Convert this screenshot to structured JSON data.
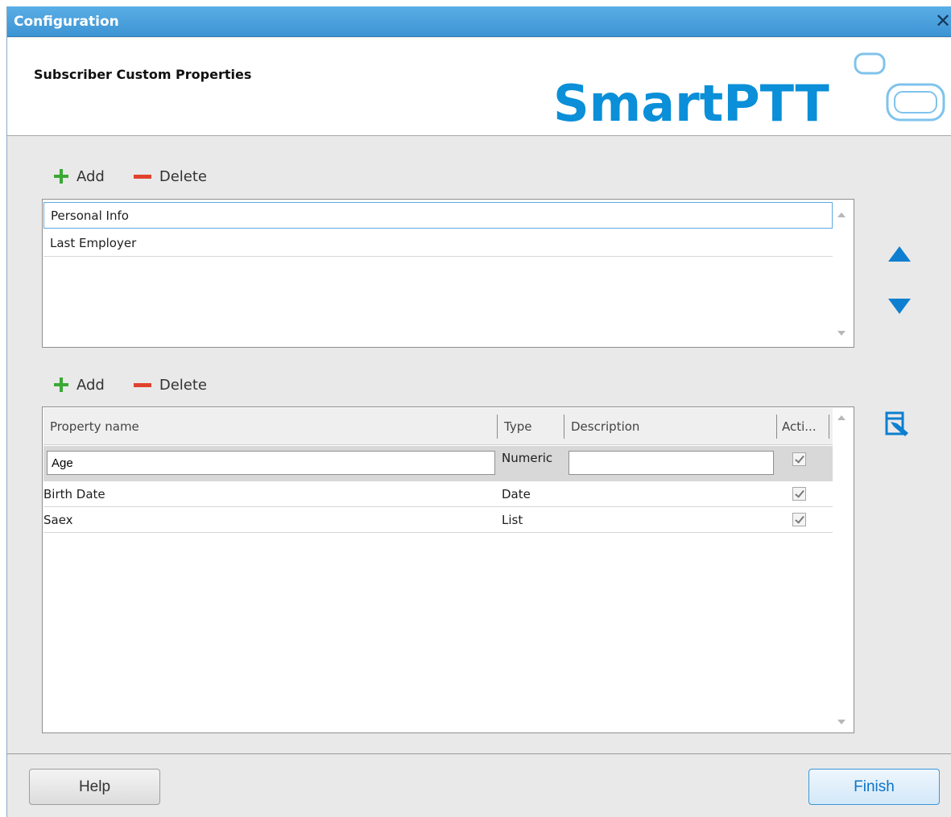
{
  "window": {
    "title": "Configuration",
    "close_glyph": "✕"
  },
  "header": {
    "heading": "Subscriber Custom Properties",
    "logo_text": "SmartPTT"
  },
  "groups_toolbar": {
    "add_label": "Add",
    "delete_label": "Delete"
  },
  "groups_list": {
    "items": [
      "Personal Info",
      "Last Employer"
    ],
    "selected_index": 0
  },
  "properties_toolbar": {
    "add_label": "Add",
    "delete_label": "Delete"
  },
  "properties_grid": {
    "columns": [
      "Property name",
      "Type",
      "Description",
      "Acti..."
    ],
    "edit_row": {
      "name": "Age",
      "type": "Numeric",
      "description": "",
      "active": true
    },
    "rows": [
      {
        "name": "Birth Date",
        "type": "Date",
        "description": "",
        "active": true
      },
      {
        "name": "Saex",
        "type": "List",
        "description": "",
        "active": true
      }
    ]
  },
  "side_icons": [
    "move-up-icon",
    "move-down-icon",
    "edit-list-icon"
  ],
  "footer": {
    "help_label": "Help",
    "finish_label": "Finish"
  },
  "colors": {
    "titlebar": "#4aa2e0",
    "accent_blue": "#0e7fd0",
    "add_green": "#3aa935",
    "delete_red": "#e0422e"
  }
}
